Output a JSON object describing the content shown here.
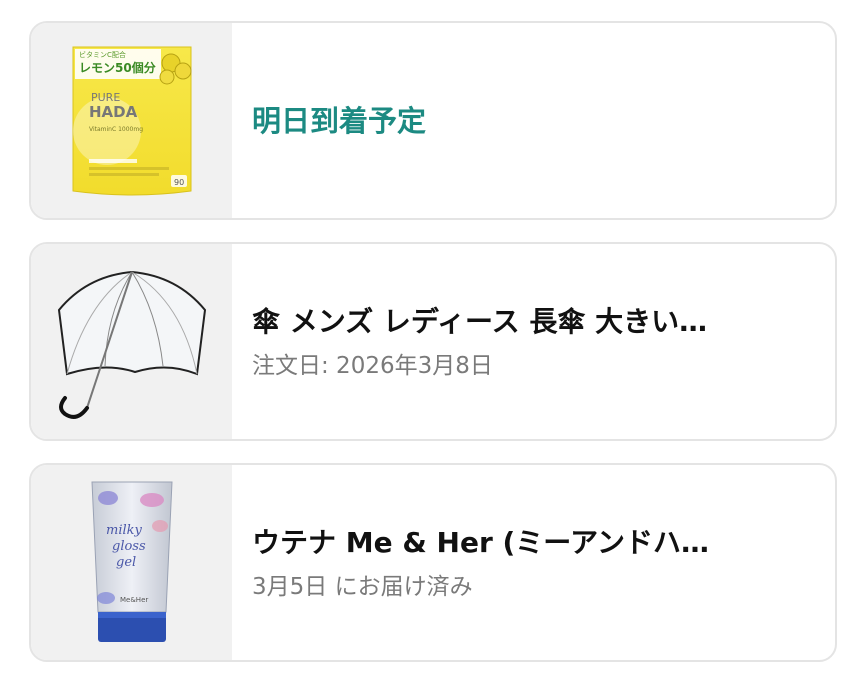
{
  "orders": [
    {
      "status": "明日到着予定",
      "status_color": "#1c8a82",
      "image": {
        "icon": "vitamin-c-supplement-pouch-icon",
        "badge": "ビタミンC配合",
        "headline": "レモン50個分",
        "brand_line1": "PURE",
        "brand_line2": "HADA",
        "tagline": "VitaminC 1000mg",
        "count": "90"
      }
    },
    {
      "title": "傘 メンズ レディース 長傘 大きい…",
      "subtitle": "注文日: 2026年3月8日",
      "image": {
        "icon": "clear-umbrella-icon"
      }
    },
    {
      "title": "ウテナ Me & Her (ミーアンドハ…",
      "subtitle": "3月5日 にお届け済み",
      "image": {
        "icon": "milky-gloss-gel-tube-icon",
        "line1": "milky",
        "line2": "gloss",
        "line3": "gel",
        "brand": "Me&Her"
      }
    }
  ]
}
